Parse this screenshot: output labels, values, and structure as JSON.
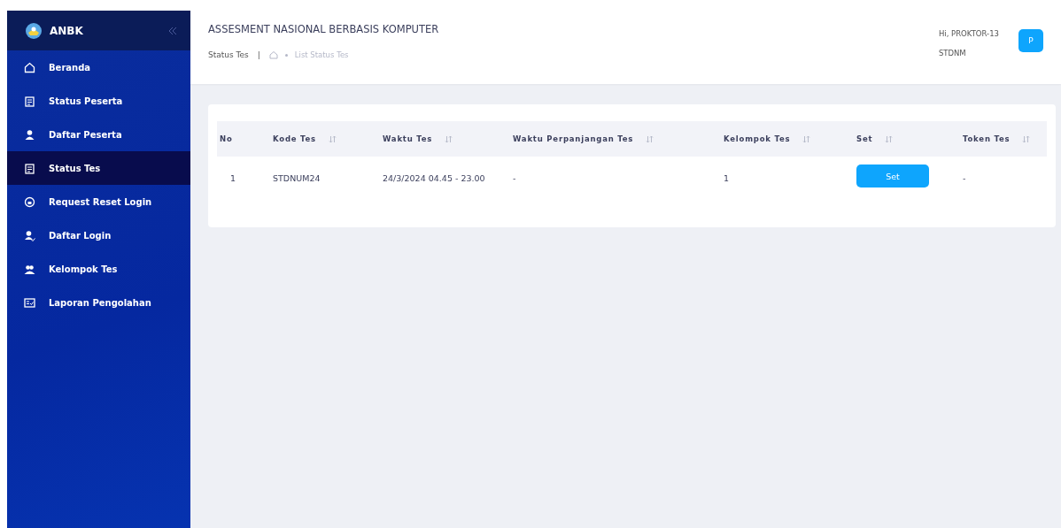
{
  "brand": "ANBK",
  "sidebar": {
    "items": [
      {
        "label": "Beranda",
        "selected": false
      },
      {
        "label": "Status Peserta",
        "selected": false
      },
      {
        "label": "Daftar Peserta",
        "selected": false
      },
      {
        "label": "Status Tes",
        "selected": true
      },
      {
        "label": "Request Reset Login",
        "selected": false
      },
      {
        "label": "Daftar Login",
        "selected": false
      },
      {
        "label": "Kelompok Tes",
        "selected": false
      },
      {
        "label": "Laporan Pengolahan",
        "selected": false
      }
    ]
  },
  "header": {
    "title": "ASSESMENT NASIONAL BERBASIS KOMPUTER",
    "greeting": "Hi, PROKTOR-13",
    "user": "STDNM",
    "avatar": "P"
  },
  "breadcrumb": {
    "page": "Status Tes",
    "separator": "|",
    "trail": "List Status Tes"
  },
  "table": {
    "columns": [
      {
        "label": "No",
        "sortable": false
      },
      {
        "label": "Kode Tes",
        "sortable": true
      },
      {
        "label": "Waktu Tes",
        "sortable": true
      },
      {
        "label": "Waktu Perpanjangan Tes",
        "sortable": true
      },
      {
        "label": "Kelompok Tes",
        "sortable": true
      },
      {
        "label": "Set",
        "sortable": true
      },
      {
        "label": "Token Tes",
        "sortable": true
      }
    ],
    "rows": [
      [
        {
          "kind": "text",
          "text": "1"
        },
        {
          "kind": "text",
          "text": "STDNUM24"
        },
        {
          "kind": "text",
          "text": "24/3/2024 04.45 - 23.00"
        },
        {
          "kind": "text",
          "text": "-"
        },
        {
          "kind": "text",
          "text": "1"
        },
        {
          "kind": "button",
          "text": "Set"
        },
        {
          "kind": "text",
          "text": "-"
        }
      ]
    ]
  }
}
